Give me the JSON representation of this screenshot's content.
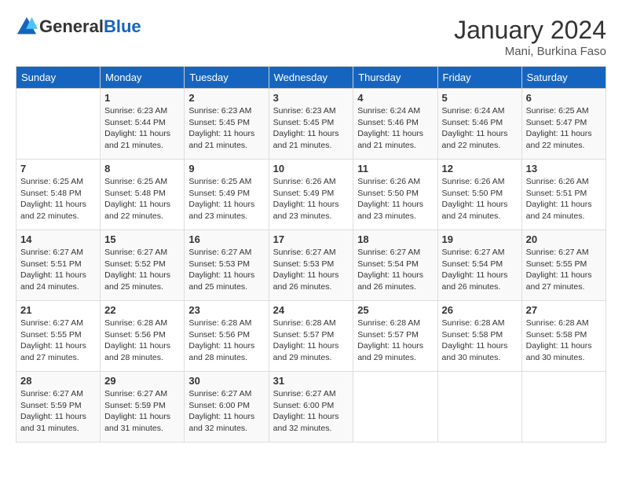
{
  "header": {
    "logo_general": "General",
    "logo_blue": "Blue",
    "month_year": "January 2024",
    "location": "Mani, Burkina Faso"
  },
  "days_of_week": [
    "Sunday",
    "Monday",
    "Tuesday",
    "Wednesday",
    "Thursday",
    "Friday",
    "Saturday"
  ],
  "weeks": [
    [
      {
        "day": "",
        "empty": true
      },
      {
        "day": "1",
        "sunrise": "6:23 AM",
        "sunset": "5:44 PM",
        "daylight": "11 hours and 21 minutes."
      },
      {
        "day": "2",
        "sunrise": "6:23 AM",
        "sunset": "5:45 PM",
        "daylight": "11 hours and 21 minutes."
      },
      {
        "day": "3",
        "sunrise": "6:23 AM",
        "sunset": "5:45 PM",
        "daylight": "11 hours and 21 minutes."
      },
      {
        "day": "4",
        "sunrise": "6:24 AM",
        "sunset": "5:46 PM",
        "daylight": "11 hours and 21 minutes."
      },
      {
        "day": "5",
        "sunrise": "6:24 AM",
        "sunset": "5:46 PM",
        "daylight": "11 hours and 22 minutes."
      },
      {
        "day": "6",
        "sunrise": "6:25 AM",
        "sunset": "5:47 PM",
        "daylight": "11 hours and 22 minutes."
      }
    ],
    [
      {
        "day": "7",
        "sunrise": "6:25 AM",
        "sunset": "5:48 PM",
        "daylight": "11 hours and 22 minutes."
      },
      {
        "day": "8",
        "sunrise": "6:25 AM",
        "sunset": "5:48 PM",
        "daylight": "11 hours and 22 minutes."
      },
      {
        "day": "9",
        "sunrise": "6:25 AM",
        "sunset": "5:49 PM",
        "daylight": "11 hours and 23 minutes."
      },
      {
        "day": "10",
        "sunrise": "6:26 AM",
        "sunset": "5:49 PM",
        "daylight": "11 hours and 23 minutes."
      },
      {
        "day": "11",
        "sunrise": "6:26 AM",
        "sunset": "5:50 PM",
        "daylight": "11 hours and 23 minutes."
      },
      {
        "day": "12",
        "sunrise": "6:26 AM",
        "sunset": "5:50 PM",
        "daylight": "11 hours and 24 minutes."
      },
      {
        "day": "13",
        "sunrise": "6:26 AM",
        "sunset": "5:51 PM",
        "daylight": "11 hours and 24 minutes."
      }
    ],
    [
      {
        "day": "14",
        "sunrise": "6:27 AM",
        "sunset": "5:51 PM",
        "daylight": "11 hours and 24 minutes."
      },
      {
        "day": "15",
        "sunrise": "6:27 AM",
        "sunset": "5:52 PM",
        "daylight": "11 hours and 25 minutes."
      },
      {
        "day": "16",
        "sunrise": "6:27 AM",
        "sunset": "5:53 PM",
        "daylight": "11 hours and 25 minutes."
      },
      {
        "day": "17",
        "sunrise": "6:27 AM",
        "sunset": "5:53 PM",
        "daylight": "11 hours and 26 minutes."
      },
      {
        "day": "18",
        "sunrise": "6:27 AM",
        "sunset": "5:54 PM",
        "daylight": "11 hours and 26 minutes."
      },
      {
        "day": "19",
        "sunrise": "6:27 AM",
        "sunset": "5:54 PM",
        "daylight": "11 hours and 26 minutes."
      },
      {
        "day": "20",
        "sunrise": "6:27 AM",
        "sunset": "5:55 PM",
        "daylight": "11 hours and 27 minutes."
      }
    ],
    [
      {
        "day": "21",
        "sunrise": "6:27 AM",
        "sunset": "5:55 PM",
        "daylight": "11 hours and 27 minutes."
      },
      {
        "day": "22",
        "sunrise": "6:28 AM",
        "sunset": "5:56 PM",
        "daylight": "11 hours and 28 minutes."
      },
      {
        "day": "23",
        "sunrise": "6:28 AM",
        "sunset": "5:56 PM",
        "daylight": "11 hours and 28 minutes."
      },
      {
        "day": "24",
        "sunrise": "6:28 AM",
        "sunset": "5:57 PM",
        "daylight": "11 hours and 29 minutes."
      },
      {
        "day": "25",
        "sunrise": "6:28 AM",
        "sunset": "5:57 PM",
        "daylight": "11 hours and 29 minutes."
      },
      {
        "day": "26",
        "sunrise": "6:28 AM",
        "sunset": "5:58 PM",
        "daylight": "11 hours and 30 minutes."
      },
      {
        "day": "27",
        "sunrise": "6:28 AM",
        "sunset": "5:58 PM",
        "daylight": "11 hours and 30 minutes."
      }
    ],
    [
      {
        "day": "28",
        "sunrise": "6:27 AM",
        "sunset": "5:59 PM",
        "daylight": "11 hours and 31 minutes."
      },
      {
        "day": "29",
        "sunrise": "6:27 AM",
        "sunset": "5:59 PM",
        "daylight": "11 hours and 31 minutes."
      },
      {
        "day": "30",
        "sunrise": "6:27 AM",
        "sunset": "6:00 PM",
        "daylight": "11 hours and 32 minutes."
      },
      {
        "day": "31",
        "sunrise": "6:27 AM",
        "sunset": "6:00 PM",
        "daylight": "11 hours and 32 minutes."
      },
      {
        "day": "",
        "empty": true
      },
      {
        "day": "",
        "empty": true
      },
      {
        "day": "",
        "empty": true
      }
    ]
  ],
  "labels": {
    "sunrise": "Sunrise:",
    "sunset": "Sunset:",
    "daylight": "Daylight:"
  }
}
